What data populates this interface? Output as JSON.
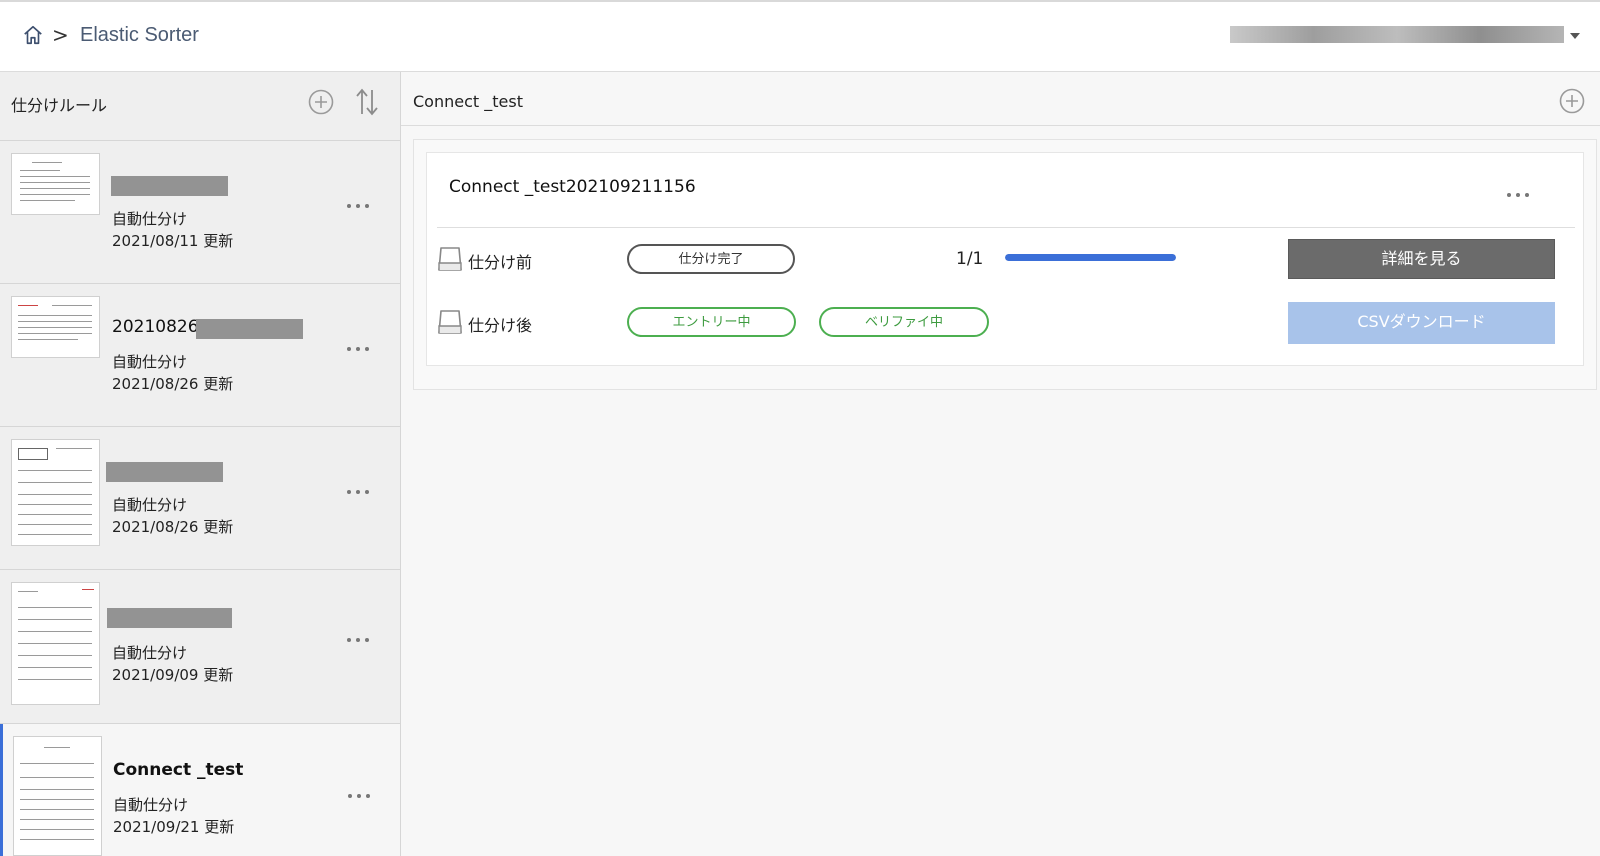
{
  "header": {
    "breadcrumb_sep": ">",
    "app_title": "Elastic Sorter",
    "home_icon": "home-icon",
    "user_menu_icon": "caret-down-icon"
  },
  "sidebar": {
    "title": "仕分けルール",
    "add_icon": "plus-circle-icon",
    "sort_icon": "sort-icon",
    "items": [
      {
        "name": "",
        "type": "自動仕分け",
        "date": "2021/08/11 更新"
      },
      {
        "name": "20210826",
        "type": "自動仕分け",
        "date": "2021/08/26 更新"
      },
      {
        "name": "",
        "type": "自動仕分け",
        "date": "2021/08/26 更新"
      },
      {
        "name": "",
        "type": "自動仕分け",
        "date": "2021/09/09 更新"
      },
      {
        "name": "Connect _test",
        "type": "自動仕分け",
        "date": "2021/09/21 更新"
      }
    ]
  },
  "main": {
    "title": "Connect _test",
    "add_icon": "plus-circle-icon",
    "card": {
      "title": "Connect _test202109211156",
      "before": {
        "label": "仕分け前",
        "status": "仕分け完了",
        "count": "1/1",
        "progress": 1.0,
        "button": "詳細を見る"
      },
      "after": {
        "label": "仕分け後",
        "status_entry": "エントリー中",
        "status_verify": "ベリファイ中",
        "button": "CSVダウンロード"
      }
    }
  },
  "colors": {
    "accent": "#3b6fd8",
    "success": "#4caf50",
    "detail_button": "#6b6b6b",
    "csv_button_disabled": "#a8c3ea"
  }
}
